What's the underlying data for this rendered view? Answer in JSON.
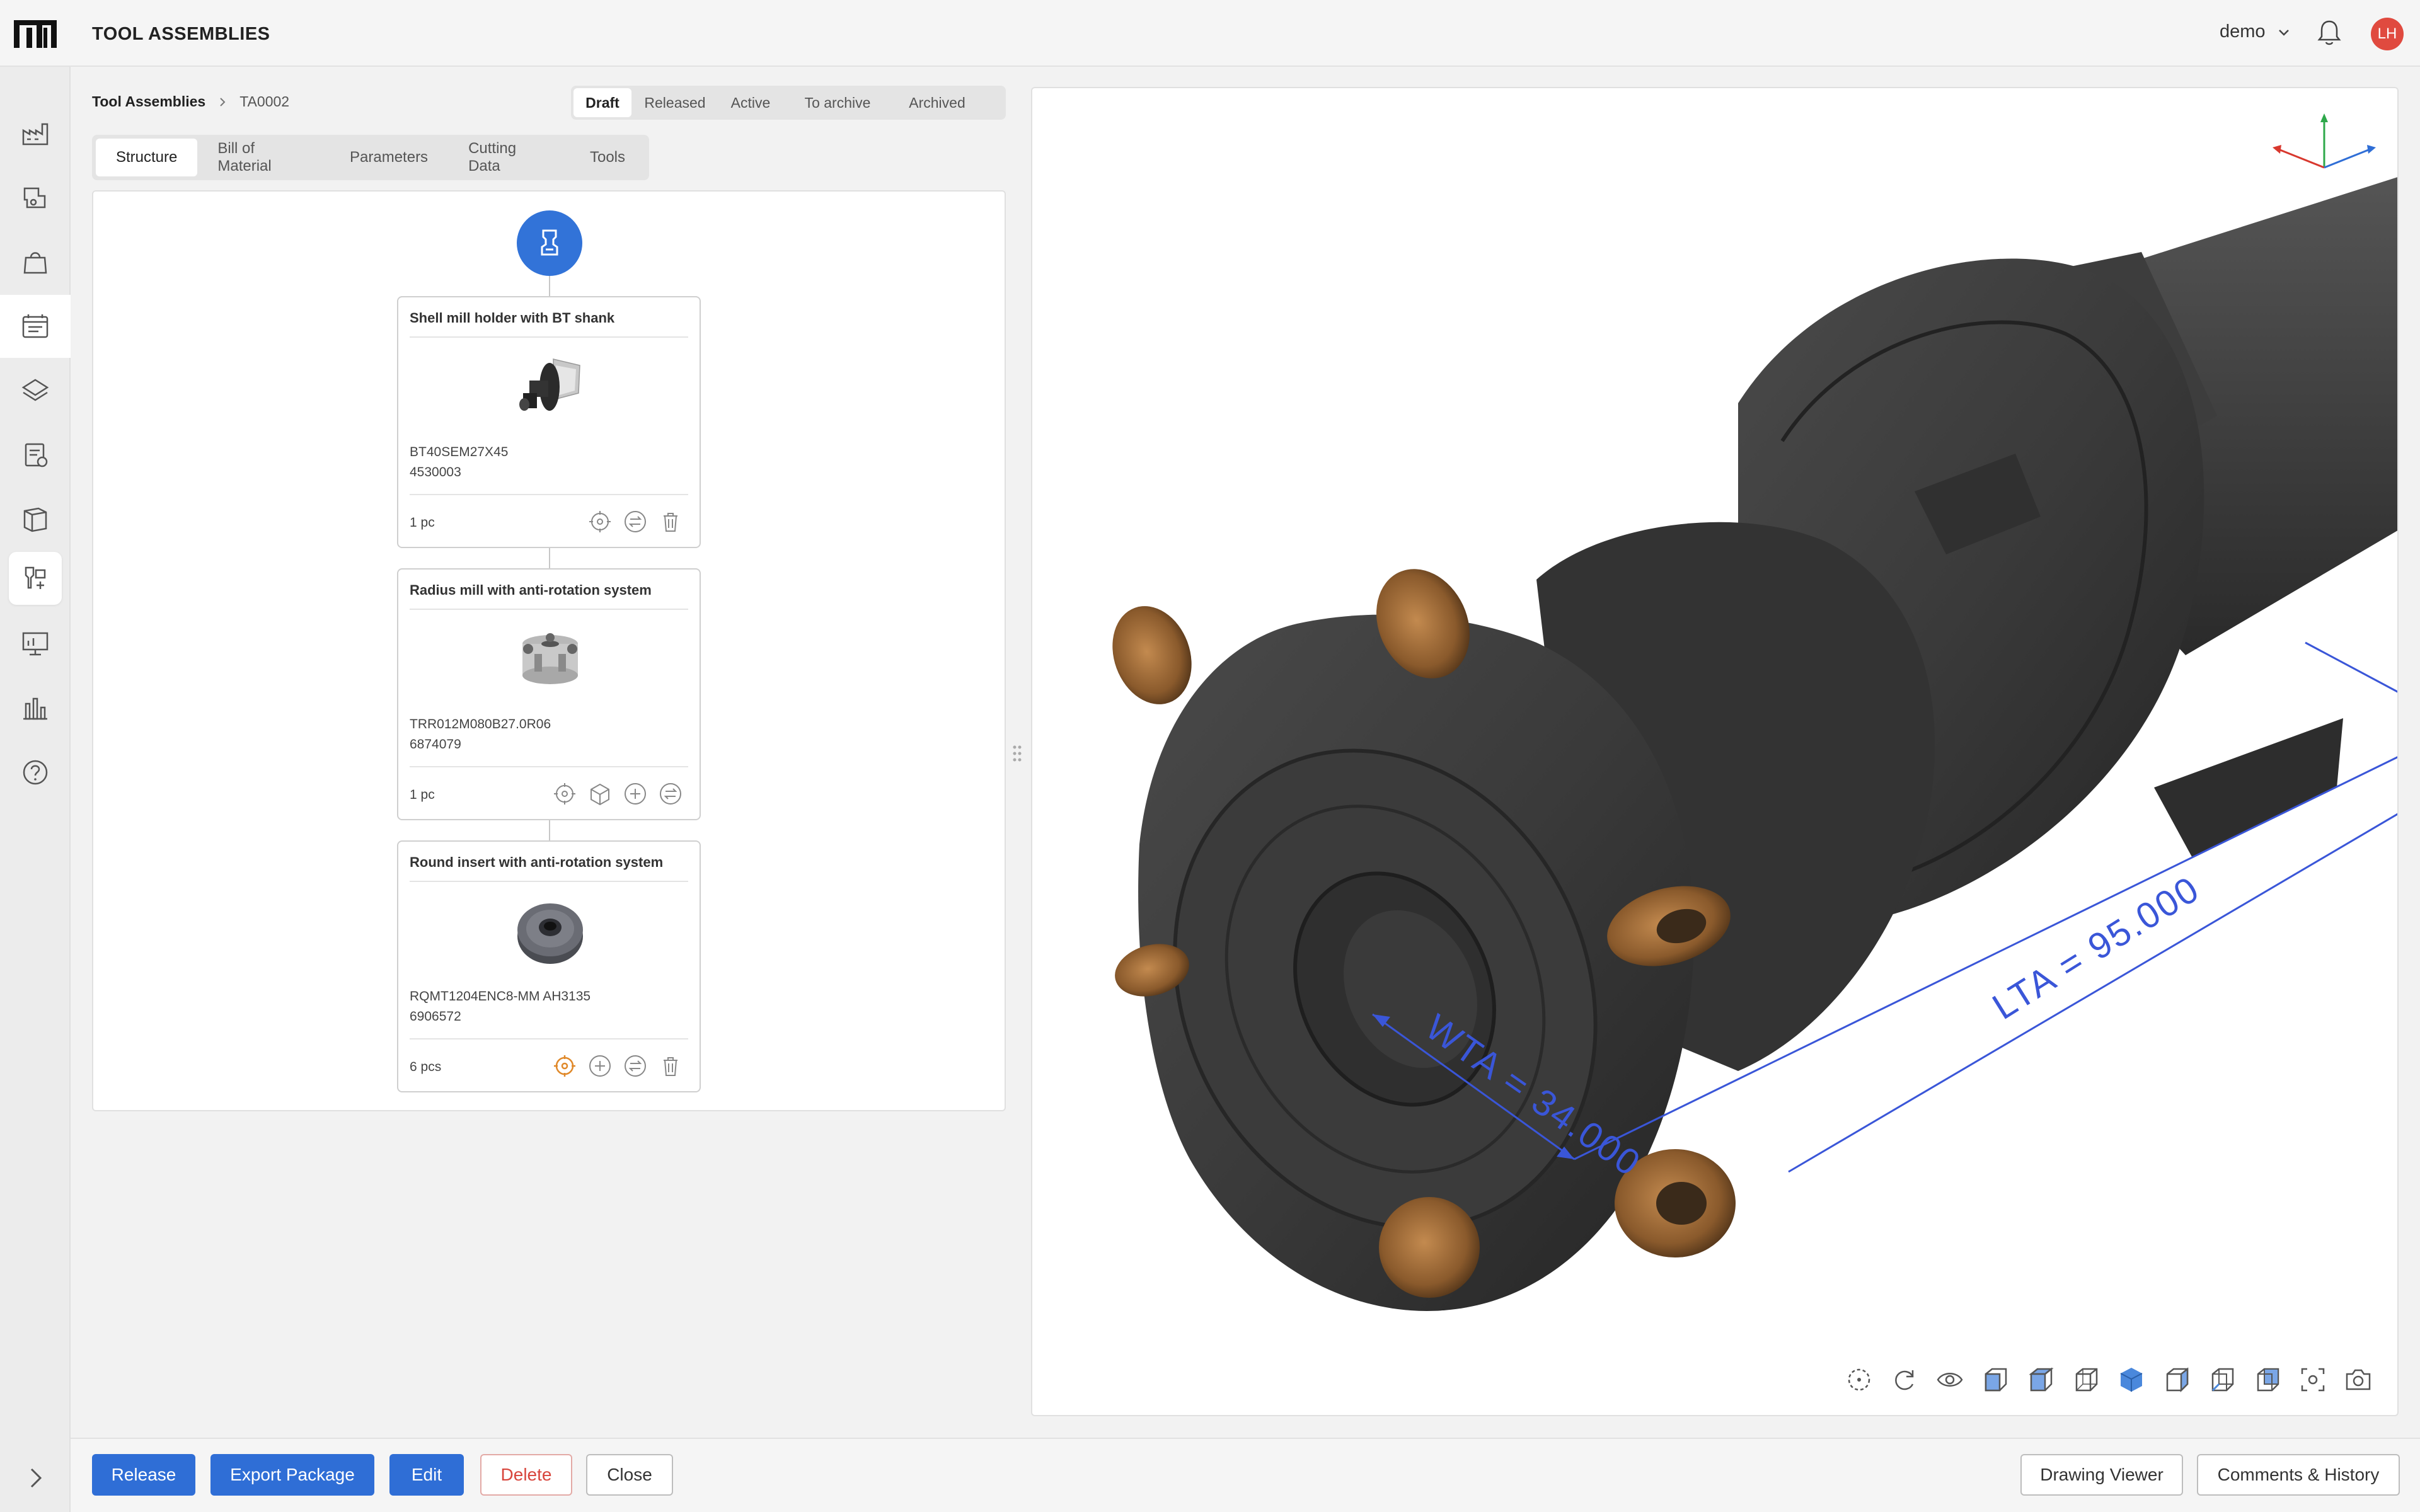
{
  "header": {
    "app_title": "TOOL ASSEMBLIES",
    "user": "demo",
    "avatar_initials": "LH"
  },
  "sidebar": {
    "items": [
      {
        "icon": "factory-icon"
      },
      {
        "icon": "machine-icon"
      },
      {
        "icon": "bag-icon"
      },
      {
        "icon": "calendar-list-icon",
        "active": true
      },
      {
        "icon": "layers-icon"
      },
      {
        "icon": "clipboard-icon"
      },
      {
        "icon": "cube-sheet-icon"
      },
      {
        "icon": "tool-assembly-icon",
        "selected": true
      },
      {
        "icon": "presentation-icon"
      },
      {
        "icon": "bar-chart-icon"
      },
      {
        "icon": "help-icon"
      }
    ]
  },
  "breadcrumb": {
    "parent": "Tool Assemblies",
    "current": "TA0002"
  },
  "status": {
    "steps": [
      "Draft",
      "Released",
      "Active",
      "To archive",
      "Archived"
    ],
    "current": "Draft"
  },
  "tabs": [
    "Structure",
    "Bill of Material",
    "Parameters",
    "Cutting Data",
    "Tools"
  ],
  "structure": {
    "nodes": [
      {
        "title": "Shell mill holder with BT shank",
        "code": "BT40SEM27X45",
        "id": "4530003",
        "qty": "1 pc"
      },
      {
        "title": "Radius mill with anti-rotation system",
        "code": "TRR012M080B27.0R06",
        "id": "6874079",
        "qty": "1 pc"
      },
      {
        "title": "Round insert with anti-rotation system",
        "code": "RQMT1204ENC8-MM AH3135",
        "id": "6906572",
        "qty": "6 pcs"
      }
    ]
  },
  "viewer": {
    "dim_wta": "WTA = 34.000",
    "dim_lta": "LTA = 95.000",
    "accent": "#3a56d8"
  },
  "footer": {
    "release": "Release",
    "export": "Export Package",
    "edit": "Edit",
    "delete": "Delete",
    "close": "Close",
    "drawing_viewer": "Drawing Viewer",
    "comments": "Comments & History"
  }
}
